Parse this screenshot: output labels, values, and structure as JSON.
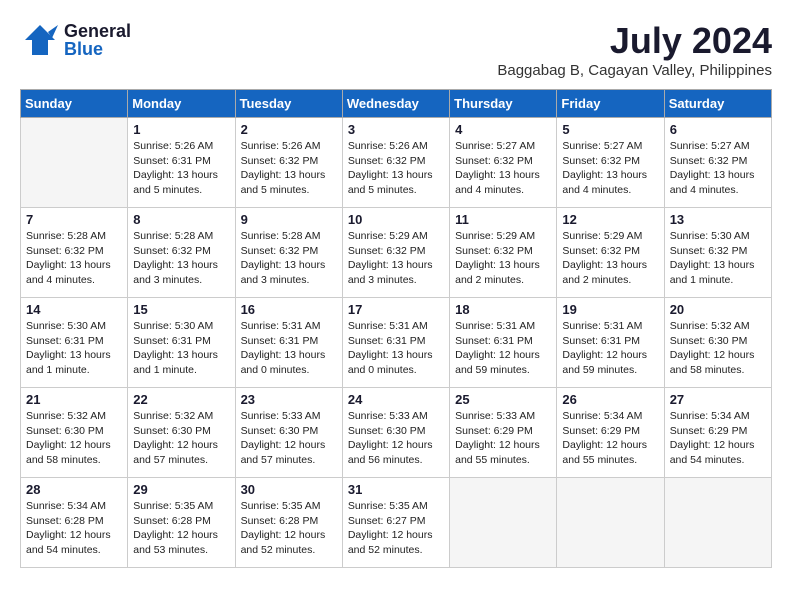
{
  "header": {
    "logo_general": "General",
    "logo_blue": "Blue",
    "month_title": "July 2024",
    "location": "Baggabag B, Cagayan Valley, Philippines"
  },
  "weekdays": [
    "Sunday",
    "Monday",
    "Tuesday",
    "Wednesday",
    "Thursday",
    "Friday",
    "Saturday"
  ],
  "weeks": [
    [
      {
        "day": "",
        "info": ""
      },
      {
        "day": "1",
        "info": "Sunrise: 5:26 AM\nSunset: 6:31 PM\nDaylight: 13 hours\nand 5 minutes."
      },
      {
        "day": "2",
        "info": "Sunrise: 5:26 AM\nSunset: 6:32 PM\nDaylight: 13 hours\nand 5 minutes."
      },
      {
        "day": "3",
        "info": "Sunrise: 5:26 AM\nSunset: 6:32 PM\nDaylight: 13 hours\nand 5 minutes."
      },
      {
        "day": "4",
        "info": "Sunrise: 5:27 AM\nSunset: 6:32 PM\nDaylight: 13 hours\nand 4 minutes."
      },
      {
        "day": "5",
        "info": "Sunrise: 5:27 AM\nSunset: 6:32 PM\nDaylight: 13 hours\nand 4 minutes."
      },
      {
        "day": "6",
        "info": "Sunrise: 5:27 AM\nSunset: 6:32 PM\nDaylight: 13 hours\nand 4 minutes."
      }
    ],
    [
      {
        "day": "7",
        "info": "Sunrise: 5:28 AM\nSunset: 6:32 PM\nDaylight: 13 hours\nand 4 minutes."
      },
      {
        "day": "8",
        "info": "Sunrise: 5:28 AM\nSunset: 6:32 PM\nDaylight: 13 hours\nand 3 minutes."
      },
      {
        "day": "9",
        "info": "Sunrise: 5:28 AM\nSunset: 6:32 PM\nDaylight: 13 hours\nand 3 minutes."
      },
      {
        "day": "10",
        "info": "Sunrise: 5:29 AM\nSunset: 6:32 PM\nDaylight: 13 hours\nand 3 minutes."
      },
      {
        "day": "11",
        "info": "Sunrise: 5:29 AM\nSunset: 6:32 PM\nDaylight: 13 hours\nand 2 minutes."
      },
      {
        "day": "12",
        "info": "Sunrise: 5:29 AM\nSunset: 6:32 PM\nDaylight: 13 hours\nand 2 minutes."
      },
      {
        "day": "13",
        "info": "Sunrise: 5:30 AM\nSunset: 6:32 PM\nDaylight: 13 hours\nand 1 minute."
      }
    ],
    [
      {
        "day": "14",
        "info": "Sunrise: 5:30 AM\nSunset: 6:31 PM\nDaylight: 13 hours\nand 1 minute."
      },
      {
        "day": "15",
        "info": "Sunrise: 5:30 AM\nSunset: 6:31 PM\nDaylight: 13 hours\nand 1 minute."
      },
      {
        "day": "16",
        "info": "Sunrise: 5:31 AM\nSunset: 6:31 PM\nDaylight: 13 hours\nand 0 minutes."
      },
      {
        "day": "17",
        "info": "Sunrise: 5:31 AM\nSunset: 6:31 PM\nDaylight: 13 hours\nand 0 minutes."
      },
      {
        "day": "18",
        "info": "Sunrise: 5:31 AM\nSunset: 6:31 PM\nDaylight: 12 hours\nand 59 minutes."
      },
      {
        "day": "19",
        "info": "Sunrise: 5:31 AM\nSunset: 6:31 PM\nDaylight: 12 hours\nand 59 minutes."
      },
      {
        "day": "20",
        "info": "Sunrise: 5:32 AM\nSunset: 6:30 PM\nDaylight: 12 hours\nand 58 minutes."
      }
    ],
    [
      {
        "day": "21",
        "info": "Sunrise: 5:32 AM\nSunset: 6:30 PM\nDaylight: 12 hours\nand 58 minutes."
      },
      {
        "day": "22",
        "info": "Sunrise: 5:32 AM\nSunset: 6:30 PM\nDaylight: 12 hours\nand 57 minutes."
      },
      {
        "day": "23",
        "info": "Sunrise: 5:33 AM\nSunset: 6:30 PM\nDaylight: 12 hours\nand 57 minutes."
      },
      {
        "day": "24",
        "info": "Sunrise: 5:33 AM\nSunset: 6:30 PM\nDaylight: 12 hours\nand 56 minutes."
      },
      {
        "day": "25",
        "info": "Sunrise: 5:33 AM\nSunset: 6:29 PM\nDaylight: 12 hours\nand 55 minutes."
      },
      {
        "day": "26",
        "info": "Sunrise: 5:34 AM\nSunset: 6:29 PM\nDaylight: 12 hours\nand 55 minutes."
      },
      {
        "day": "27",
        "info": "Sunrise: 5:34 AM\nSunset: 6:29 PM\nDaylight: 12 hours\nand 54 minutes."
      }
    ],
    [
      {
        "day": "28",
        "info": "Sunrise: 5:34 AM\nSunset: 6:28 PM\nDaylight: 12 hours\nand 54 minutes."
      },
      {
        "day": "29",
        "info": "Sunrise: 5:35 AM\nSunset: 6:28 PM\nDaylight: 12 hours\nand 53 minutes."
      },
      {
        "day": "30",
        "info": "Sunrise: 5:35 AM\nSunset: 6:28 PM\nDaylight: 12 hours\nand 52 minutes."
      },
      {
        "day": "31",
        "info": "Sunrise: 5:35 AM\nSunset: 6:27 PM\nDaylight: 12 hours\nand 52 minutes."
      },
      {
        "day": "",
        "info": ""
      },
      {
        "day": "",
        "info": ""
      },
      {
        "day": "",
        "info": ""
      }
    ]
  ]
}
